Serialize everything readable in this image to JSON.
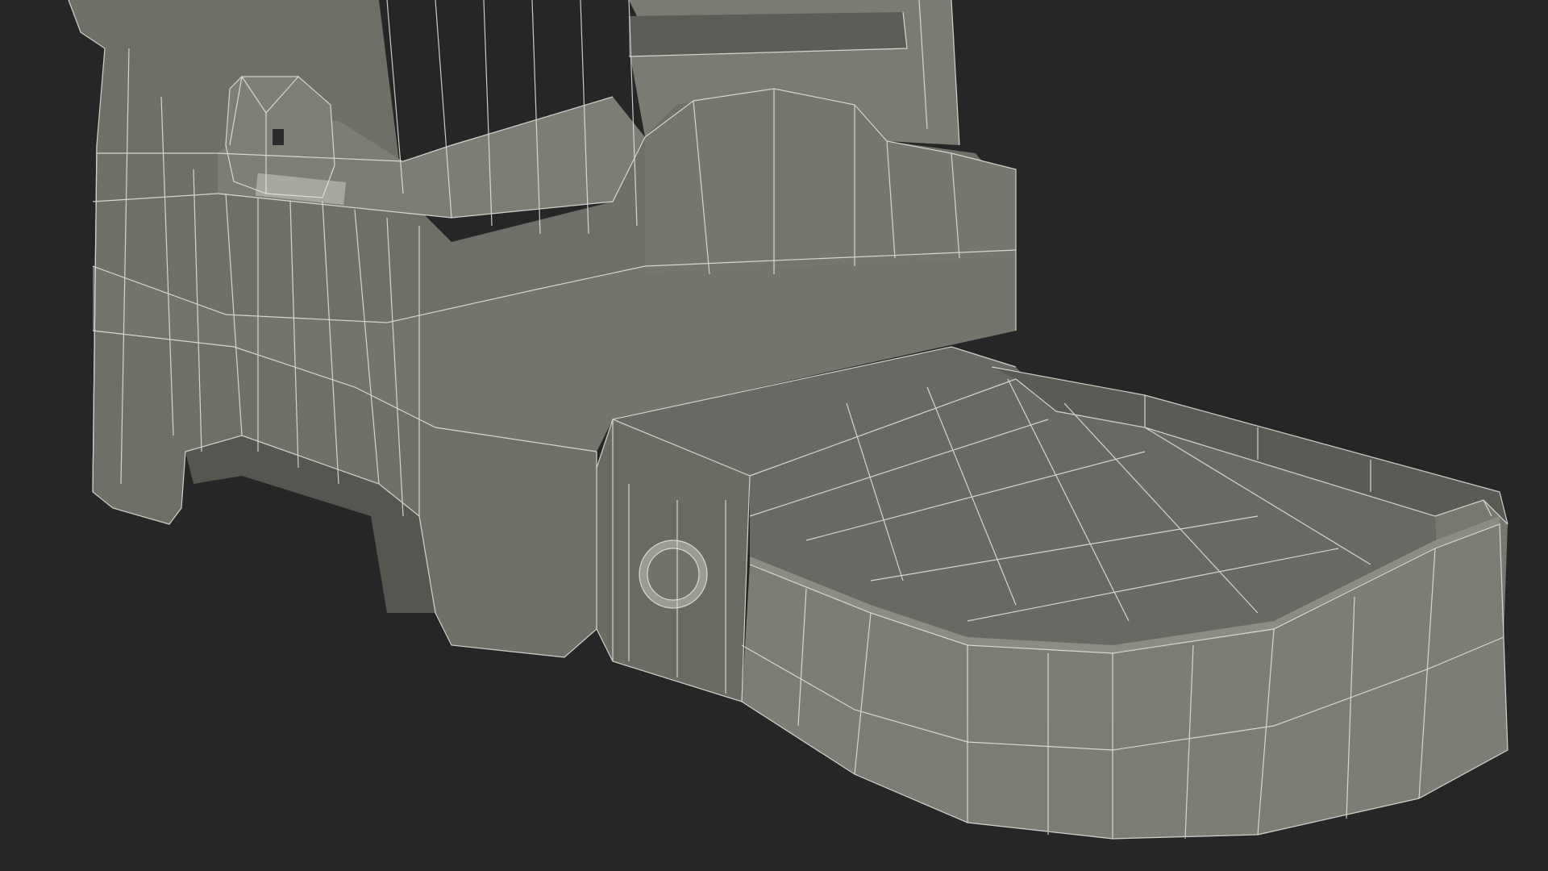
{
  "scene": {
    "description_visible_text": "",
    "colors": {
      "background": "#262626",
      "mesh_fill_light": "#7d7e74",
      "mesh_fill_mid": "#6f7068",
      "mesh_fill_dark": "#5f605a",
      "mesh_fill_shadow": "#4e4f4a",
      "wire": "#e8e8e2"
    },
    "objects": [
      "feeder-body-mesh",
      "hopper-mesh",
      "latch-clip-mesh",
      "base-arch-mesh",
      "food-tray-mesh",
      "tray-drawer-mesh",
      "round-port-mesh"
    ]
  }
}
